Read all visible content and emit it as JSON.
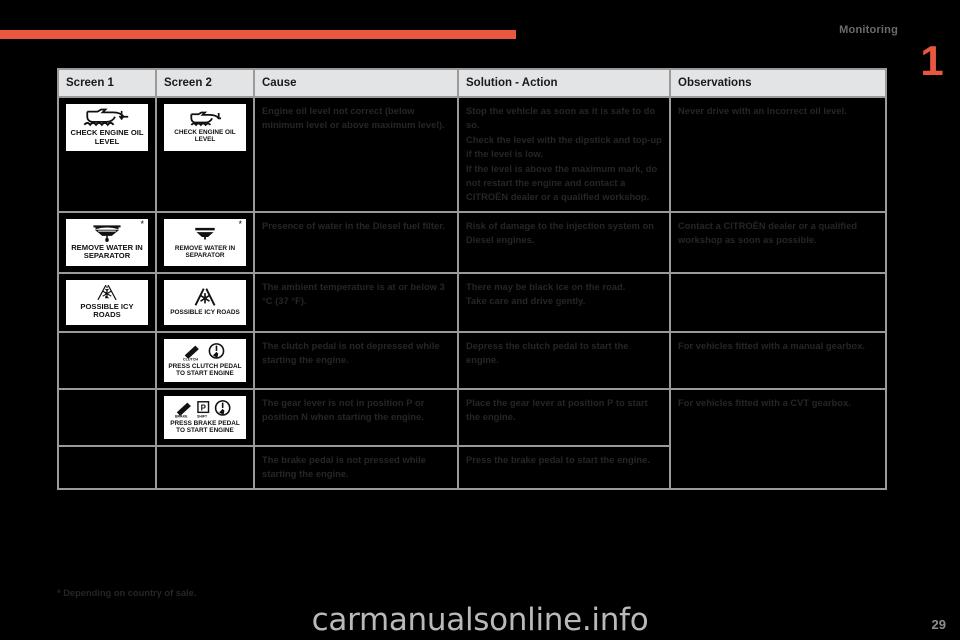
{
  "header": {
    "chapter_label": "Monitoring",
    "chapter_number": "1"
  },
  "table": {
    "columns": [
      "Screen 1",
      "Screen 2",
      "Cause",
      "Solution - Action",
      "Observations"
    ],
    "rows": [
      {
        "screen1": {
          "icon": "engine-oil-level-icon",
          "caption": "CHECK ENGINE OIL LEVEL",
          "star": ""
        },
        "screen2": {
          "icon": "engine-oil-level-icon",
          "caption": "CHECK ENGINE OIL LEVEL",
          "star": ""
        },
        "cause": "Engine oil level not correct (below minimum level or above maximum level).",
        "solution": "Stop the vehicle as soon as it is safe to do so.\nCheck the level with the dipstick and top-up if the level is low.\nIf the level is above the maximum mark, do not restart the engine and contact a CITROËN dealer or a qualified workshop.",
        "observations": "Never drive with an incorrect oil level."
      },
      {
        "screen1": {
          "icon": "water-in-separator-icon",
          "caption": "REMOVE WATER IN SEPARATOR",
          "star": "*"
        },
        "screen2": {
          "icon": "water-in-separator-icon",
          "caption": "REMOVE WATER IN SEPARATOR",
          "star": "*"
        },
        "cause": "Presence of water in the Diesel fuel filter.",
        "solution": "Risk of damage to the injection system on Diesel engines.",
        "observations": "Contact a CITROËN dealer or a qualified workshop as soon as possible."
      },
      {
        "screen1": {
          "icon": "icy-roads-icon",
          "caption": "POSSIBLE ICY ROADS",
          "star": ""
        },
        "screen2": {
          "icon": "icy-roads-icon",
          "caption": "POSSIBLE ICY ROADS",
          "star": ""
        },
        "cause": "The ambient temperature is at or below 3 °C (37 °F).",
        "solution": "There may be black ice on the road.\nTake care and drive gently.",
        "observations": ""
      },
      {
        "screen1": null,
        "screen2": {
          "icon": "press-clutch-pedal-icon",
          "caption": "PRESS CLUTCH PEDAL TO START ENGINE",
          "star": ""
        },
        "cause": "The clutch pedal is not depressed while starting the engine.",
        "solution": "Depress the clutch pedal to start the engine.",
        "observations": "For vehicles fitted with a manual gearbox."
      },
      {
        "screen1": null,
        "screen2": {
          "icon": "press-brake-pedal-icon",
          "caption": "PRESS BRAKE PEDAL TO START ENGINE",
          "star": ""
        },
        "cause": "The gear lever is not in position P or position N when starting the engine.",
        "solution": "Place the gear lever at position P to start the engine.",
        "observations": "For vehicles fitted with a CVT gearbox."
      },
      {
        "screen1": null,
        "screen2": null,
        "cause": "The brake pedal is not pressed while starting the engine.",
        "solution": "Press the brake pedal to start the engine.",
        "observations": ""
      }
    ]
  },
  "footnote": "* Depending on country of sale.",
  "watermark": "carmanualsonline.info",
  "page_number": "29",
  "colors": {
    "accent": "#e9573f",
    "header_bg": "#e3e4e6",
    "border": "#9a9a9a",
    "text": "#262626"
  }
}
